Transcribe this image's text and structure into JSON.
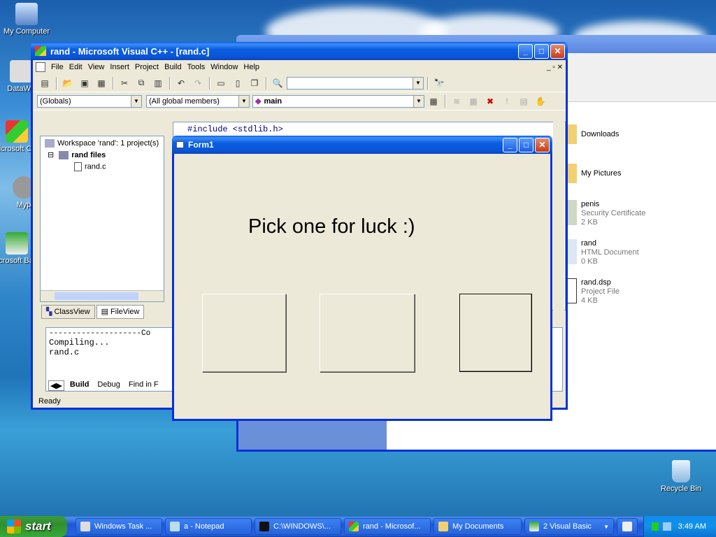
{
  "desktop": {
    "icons": [
      {
        "label": "My Computer"
      },
      {
        "label": "DataWa"
      },
      {
        "label": "Microsoft C++"
      },
      {
        "label": "Myp"
      },
      {
        "label": "Microsoft Basic"
      },
      {
        "label": "Recycle Bin"
      }
    ]
  },
  "explorer": {
    "items": [
      {
        "name": "Downloads",
        "type": "",
        "size": ""
      },
      {
        "name": "My Pictures",
        "type": "",
        "size": ""
      },
      {
        "name": "penis",
        "type": "Security Certificate",
        "size": "2 KB"
      },
      {
        "name": "rand",
        "type": "HTML Document",
        "size": "0 KB"
      },
      {
        "name": "rand.dsp",
        "type": "Project File",
        "size": "4 KB"
      }
    ]
  },
  "vcpp": {
    "title": "rand - Microsoft Visual C++ - [rand.c]",
    "menu": [
      "File",
      "Edit",
      "View",
      "Insert",
      "Project",
      "Build",
      "Tools",
      "Window",
      "Help"
    ],
    "combo_globals": "(Globals)",
    "combo_members": "(All global members)",
    "combo_main": "main",
    "workspace": {
      "root": "Workspace 'rand': 1 project(s)",
      "project": "rand files",
      "file": "rand.c"
    },
    "tabs": {
      "classview": "ClassView",
      "fileview": "FileView"
    },
    "code_line": "#include <stdlib.h>",
    "output_header": "--------------------Co",
    "output_lines": [
      "Compiling...",
      "rand.c"
    ],
    "output_tabs": [
      "Build",
      "Debug",
      "Find in F"
    ],
    "status": "Ready"
  },
  "form1": {
    "title": "Form1",
    "label": "Pick one for luck :)"
  },
  "taskbar": {
    "start": "start",
    "buttons": [
      "Windows Task ...",
      "a - Notepad",
      "C:\\WINDOWS\\...",
      "rand - Microsof...",
      "My Documents",
      "2 Visual Basic"
    ],
    "clock": "3:49 AM"
  }
}
